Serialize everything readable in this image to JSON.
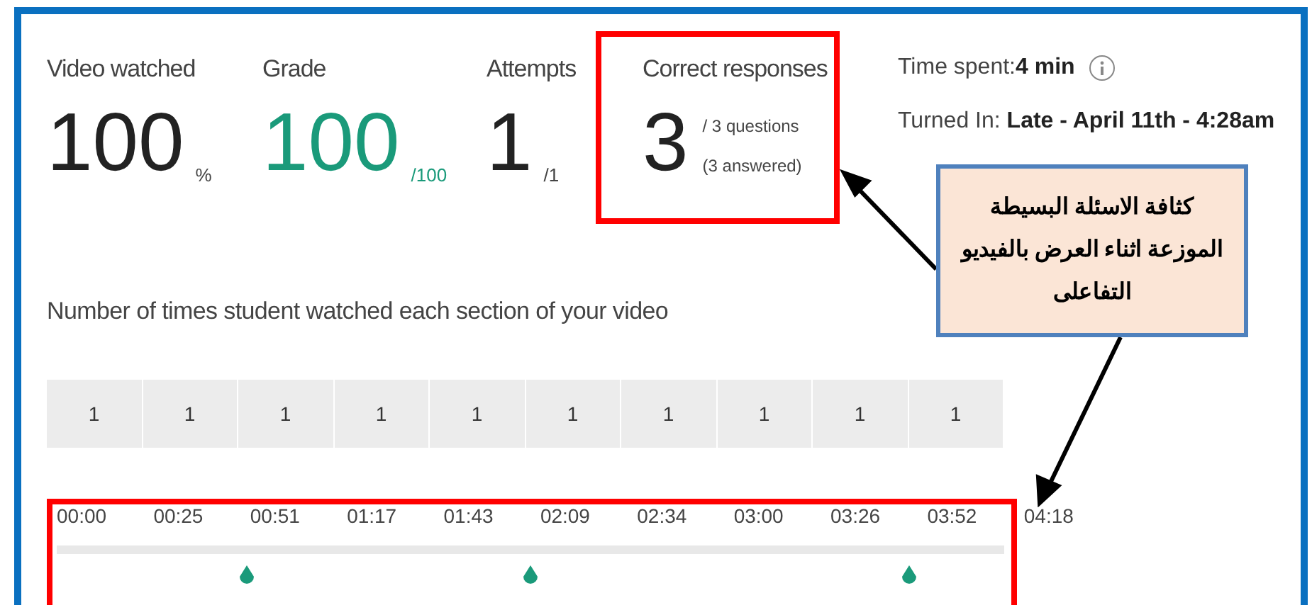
{
  "stats": [
    {
      "label": "Video watched",
      "value": "100",
      "suffix": "%",
      "kind": "plain"
    },
    {
      "label": "Grade",
      "value": "100",
      "suffix": "/100",
      "kind": "grade"
    },
    {
      "label": "Attempts",
      "value": "1",
      "suffix": "/1",
      "kind": "plain"
    },
    {
      "label": "Correct responses",
      "value": "3",
      "suffix": "/ 3 questions",
      "note": "(3 answered)",
      "kind": "responses"
    }
  ],
  "time_spent": {
    "label": "Time spent:",
    "value": "4 min"
  },
  "turned_in": {
    "label": "Turned In:",
    "value": "Late - April 11th - 4:28am"
  },
  "section_title": "Number of times student watched each section of your video",
  "counts": [
    "1",
    "1",
    "1",
    "1",
    "1",
    "1",
    "1",
    "1",
    "1",
    "1"
  ],
  "timeline": {
    "labels": [
      "00:00",
      "00:25",
      "00:51",
      "01:17",
      "01:43",
      "02:09",
      "02:34",
      "03:00",
      "03:26",
      "03:52",
      "04:18"
    ],
    "markers": [
      {
        "level": 0.2
      },
      {
        "level": 0.5
      },
      {
        "level": 0.9
      }
    ]
  },
  "callout": {
    "text": "كثافة الاسئلة  البسيطة الموزعة اثناء العرض بالفيديو التفاعلى"
  }
}
